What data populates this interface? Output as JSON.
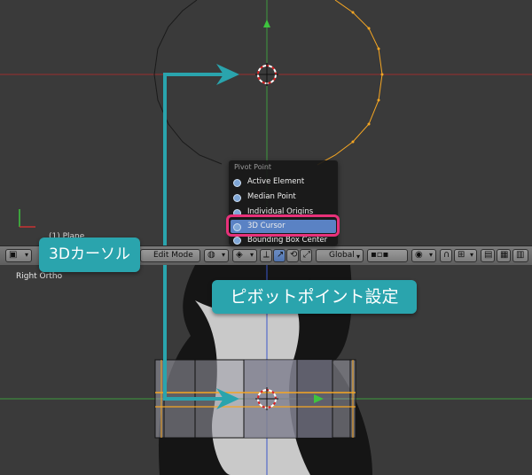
{
  "viewport": {
    "object_label": "(1) Plane",
    "view_label": "Right Ortho"
  },
  "header": {
    "mode_label": "Edit Mode",
    "orientation_label": "Global"
  },
  "pivot_menu": {
    "title": "Pivot Point",
    "items": [
      "Active Element",
      "Median Point",
      "Individual Origins",
      "3D Cursor",
      "Bounding Box Center"
    ],
    "selected": "3D Cursor"
  },
  "annotations": {
    "cursor_callout": "3Dカーソル",
    "pivot_callout": "ピボットポイント設定"
  },
  "colors": {
    "accent_teal": "#2aa4ad",
    "highlight_pink": "#e8317a",
    "selection_blue": "#5a82c4",
    "edge_orange": "#f5a623"
  }
}
